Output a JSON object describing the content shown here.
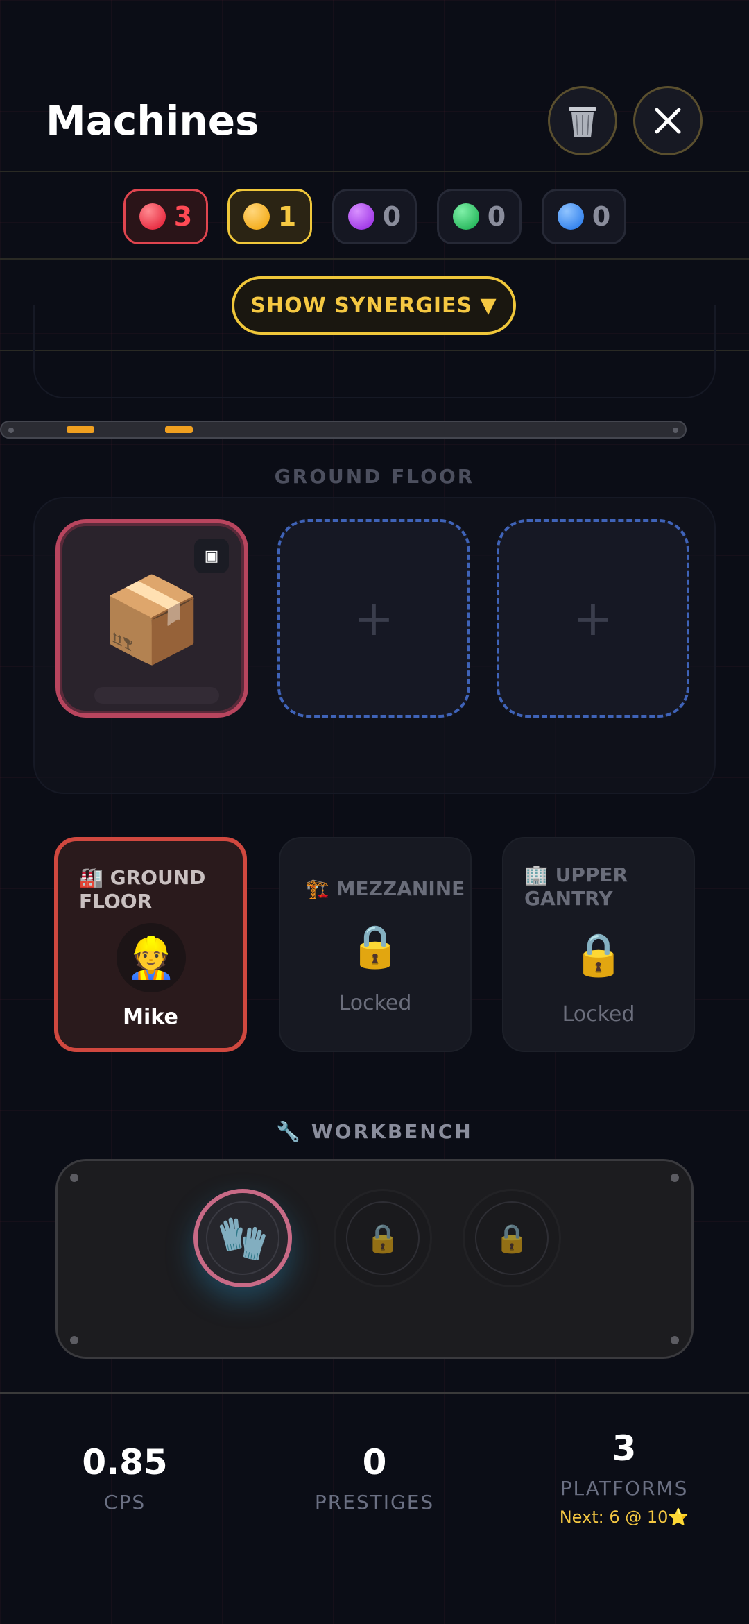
{
  "header": {
    "title": "Machines",
    "trash_icon": "wastebasket-icon",
    "close_icon": "close-icon"
  },
  "chips": [
    {
      "color_name": "red",
      "color": "#ff3b4a",
      "count": "3"
    },
    {
      "color_name": "yellow",
      "color": "#ffb020",
      "count": "1"
    },
    {
      "color_name": "purple",
      "color": "#b040f0",
      "count": "0"
    },
    {
      "color_name": "green",
      "color": "#22c060",
      "count": "0"
    },
    {
      "color_name": "blue",
      "color": "#3a8cf5",
      "count": "0"
    }
  ],
  "synergies_button": "SHOW SYNERGIES ▼",
  "floor_section_label": "GROUND FLOOR",
  "slots": {
    "filled_item": "📦",
    "empty_symbol": "+"
  },
  "floors": [
    {
      "icon": "🏭",
      "name": "GROUND FLOOR",
      "worker_emoji": "👷",
      "worker_name": "Mike",
      "active": true
    },
    {
      "icon": "🏗️",
      "name": "MEZZANINE",
      "status": "Locked",
      "lock_emoji": "🔒"
    },
    {
      "icon": "🏢",
      "name": "UPPER GANTRY",
      "status": "Locked",
      "lock_emoji": "🔒"
    }
  ],
  "workbench": {
    "label": "🔧 WORKBENCH",
    "tools": [
      {
        "emoji": "🧤",
        "locked": false
      },
      {
        "emoji": "🔒",
        "locked": true
      },
      {
        "emoji": "🔒",
        "locked": true
      }
    ]
  },
  "stats": {
    "cps_value": "0.85",
    "cps_label": "CPS",
    "prestiges_value": "0",
    "prestiges_label": "PRESTIGES",
    "platforms_value": "3",
    "platforms_label": "PLATFORMS",
    "platforms_next": "Next: 6 @ 10⭐"
  },
  "colors": {
    "accent_yellow": "#f5c842",
    "active_red": "#d0483f",
    "slot_dashed_blue": "#3f63b8"
  }
}
